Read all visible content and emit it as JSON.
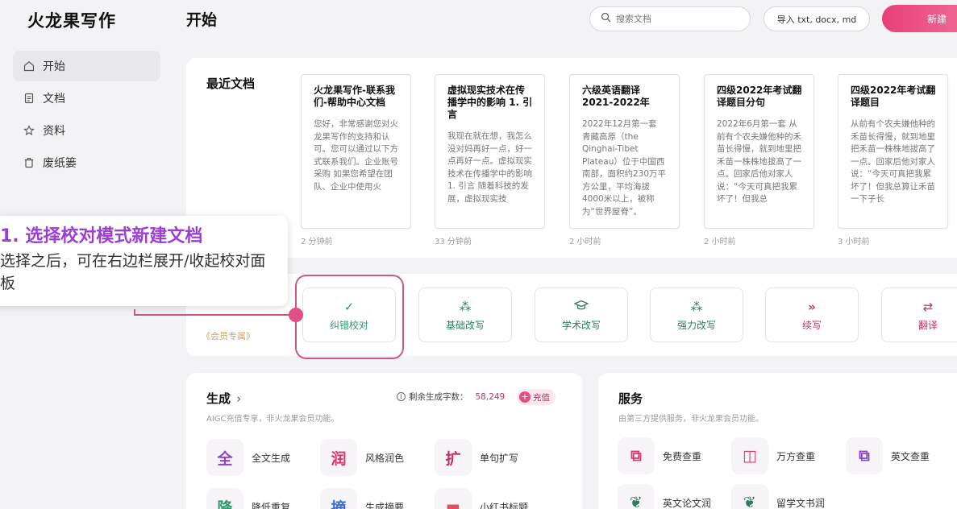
{
  "app": {
    "logo": "火龙果写作"
  },
  "sidebar": {
    "items": [
      {
        "label": "开始",
        "icon": "home-icon"
      },
      {
        "label": "文档",
        "icon": "document-icon"
      },
      {
        "label": "资料",
        "icon": "star-icon"
      },
      {
        "label": "废纸篓",
        "icon": "trash-icon"
      }
    ]
  },
  "header": {
    "title": "开始",
    "search_placeholder": "搜索文档",
    "import_label": "导入  txt, docx, md",
    "new_label": "新建"
  },
  "recent": {
    "title": "最近文档",
    "docs": [
      {
        "title": "火龙果写作-联系我们-帮助中心文档",
        "body": "您好，非常感谢您对火龙果写作的支持和认可。您可以通过以下方式联系我们。企业账号采购 如果您希望在团队、企业中使用火",
        "time": "2 分钟前"
      },
      {
        "title": "虚拟现实技术在传播学中的影响 1. 引言",
        "body": "我现在就在想，我怎么没对妈再好一点，好一点再好一点。虚拟现实技术在传播学中的影响 1. 引言 随着科技的发展，虚拟现实技",
        "time": "33 分钟前"
      },
      {
        "title": "六级英语翻译2021-2022年",
        "body": "2022年12月第一套 青藏高原（the Qinghai-Tibet Plateau）位于中国西南部，面积约230万平方公里，平均海拔4000米以上，被称为“世界屋脊”。",
        "time": "2 小时前"
      },
      {
        "title": "四级2022年考试翻译题目分句",
        "body": "2022年6月第一套 从前有个农夫嫌他种的禾苗长得慢，就到地里把禾苗一株株地拔高了一点。回家后他对家人说：“今天可真把我累坏了！但我总",
        "time": "2 小时前"
      },
      {
        "title": "四级2022年考试翻译题目",
        "body": "从前有个农夫嫌他种的禾苗长得慢，就到地里把禾苗一株株地拔高了一点。回家后他对家人说：“今天可真把我累坏了！但我总算让禾苗一下子长",
        "time": "3 小时前"
      }
    ]
  },
  "tools": {
    "member_tag": "《会员专属》",
    "items": [
      {
        "label": "纠错校对",
        "icon": "check-icon",
        "color": "#2e9b6e"
      },
      {
        "label": "基础改写",
        "icon": "magic-wand-icon",
        "color": "#2e7d5b"
      },
      {
        "label": "学术改写",
        "icon": "graduation-cap-icon",
        "color": "#2e7d5b"
      },
      {
        "label": "强力改写",
        "icon": "sparkle-wand-icon",
        "color": "#2e7d5b"
      },
      {
        "label": "续写",
        "icon": "double-chevron-icon",
        "color": "#c0306a"
      },
      {
        "label": "翻译",
        "icon": "swap-arrows-icon",
        "color": "#c0306a"
      }
    ]
  },
  "callout": {
    "title": "1. 选择校对模式新建文档",
    "body": "选择之后，可在右边栏展开/收起校对面板"
  },
  "generate": {
    "title": "生成",
    "chevron": "›",
    "subtitle": "AIGC充值专享，非火龙果会员功能。",
    "remain_label": "剩余生成字数：",
    "remain_value": "58,249",
    "recharge_label": "充值",
    "features": [
      {
        "glyph": "全",
        "label": "全文生成",
        "color": "#8e44c9"
      },
      {
        "glyph": "润",
        "label": "风格润色",
        "color": "#d9376e"
      },
      {
        "glyph": "扩",
        "label": "单句扩写",
        "color": "#c0306a"
      },
      {
        "glyph": "降",
        "label": "降低重复",
        "color": "#2e9b6e"
      },
      {
        "glyph": "摘",
        "label": "生成摘要",
        "color": "#3b6fd1"
      },
      {
        "glyph": "▬",
        "label": "小红书标题",
        "color": "#e0505a"
      }
    ]
  },
  "services": {
    "title": "服务",
    "subtitle": "由第三方提供服务，非火龙果会员功能。",
    "features": [
      {
        "glyph": "⧉",
        "label": "免费查重",
        "color": "#d9376e"
      },
      {
        "glyph": "◫",
        "label": "万方查重",
        "color": "#d9376e"
      },
      {
        "glyph": "⧉",
        "label": "英文查重",
        "color": "#8e44c9"
      },
      {
        "glyph": "❦",
        "label": "英文论文润",
        "color": "#2e7d5b"
      },
      {
        "glyph": "❦",
        "label": "留学文书润",
        "color": "#2e7d5b"
      }
    ]
  }
}
